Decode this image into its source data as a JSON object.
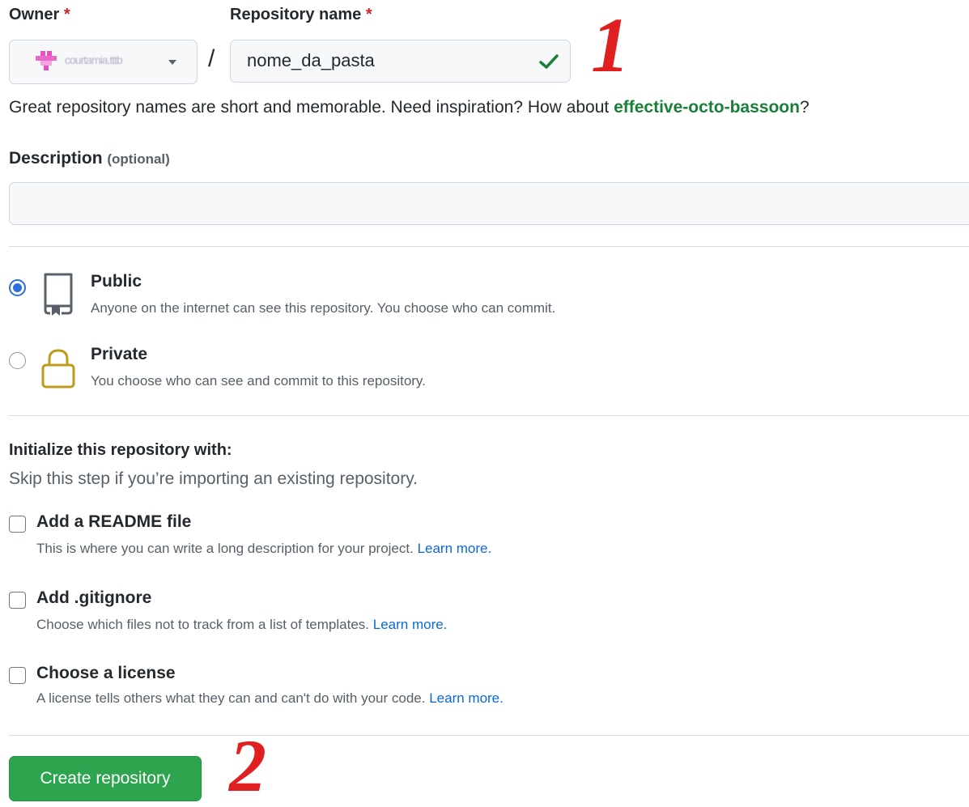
{
  "owner": {
    "label": "Owner",
    "required_mark": "*",
    "selected_value": "courtamia.tttb"
  },
  "slash": "/",
  "repository_name": {
    "label": "Repository name",
    "required_mark": "*",
    "value": "nome_da_pasta"
  },
  "annotations": {
    "step1": "1",
    "step2": "2"
  },
  "name_hint": {
    "text": "Great repository names are short and memorable. Need inspiration? How about ",
    "suggestion": "effective-octo-bassoon",
    "suffix": "?"
  },
  "description": {
    "label": "Description",
    "optional": "(optional)",
    "value": ""
  },
  "visibility": {
    "public": {
      "title": "Public",
      "subtitle": "Anyone on the internet can see this repository. You choose who can commit.",
      "checked": true
    },
    "private": {
      "title": "Private",
      "subtitle": "You choose who can see and commit to this repository.",
      "checked": false
    }
  },
  "initialize": {
    "title": "Initialize this repository with:",
    "subtitle": "Skip this step if you’re importing an existing repository.",
    "options": [
      {
        "title": "Add a README file",
        "subtitle": "This is where you can write a long description for your project.",
        "link": "Learn more."
      },
      {
        "title": "Add .gitignore",
        "subtitle": "Choose which files not to track from a list of templates.",
        "link": "Learn more."
      },
      {
        "title": "Choose a license",
        "subtitle": "A license tells others what they can and can't do with your code.",
        "link": "Learn more."
      }
    ]
  },
  "create_button": {
    "label": "Create repository"
  },
  "colors": {
    "primary_green": "#2da44e",
    "suggestion_green": "#1a7f37",
    "link_blue": "#0969da",
    "radio_blue": "#2f6fdb",
    "annotation_red": "#e02020",
    "lock_gold": "#bf9b1b"
  },
  "icons": {
    "owner_avatar": "pink-identicon",
    "name_valid": "check-icon",
    "public": "repo-icon",
    "private": "lock-icon"
  }
}
